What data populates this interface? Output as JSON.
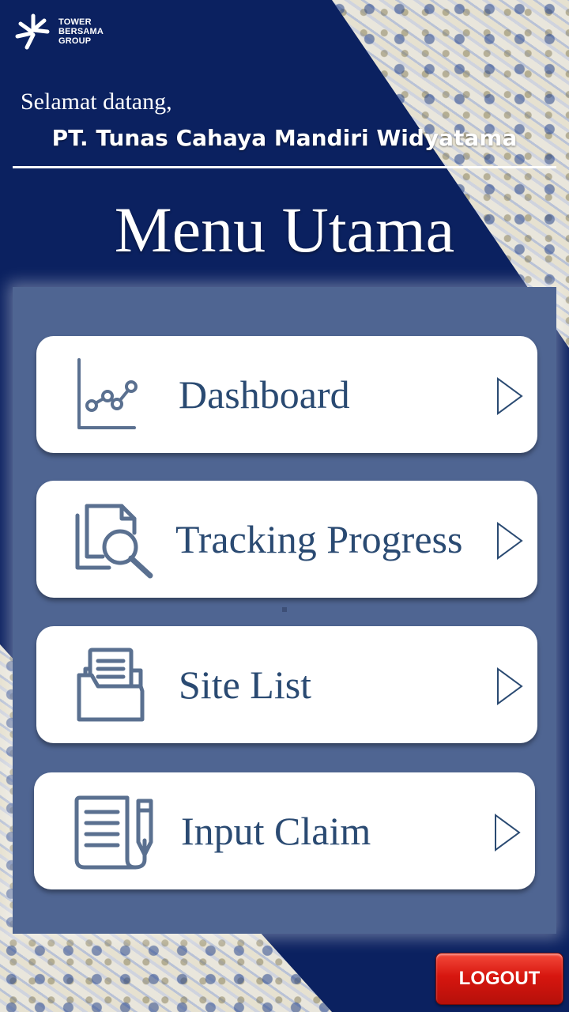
{
  "brand": {
    "line1": "TOWER",
    "line2": "BERSAMA",
    "line3": "GROUP"
  },
  "header": {
    "welcome": "Selamat datang,",
    "company": "PT. Tunas Cahaya Mandiri Widyatama",
    "title": "Menu Utama"
  },
  "menu": {
    "items": [
      {
        "label": "Dashboard",
        "icon": "line-chart-icon"
      },
      {
        "label": "Tracking Progress",
        "icon": "document-search-icon"
      },
      {
        "label": "Site List",
        "icon": "folder-documents-icon"
      },
      {
        "label": "Input Claim",
        "icon": "document-pencil-icon"
      }
    ]
  },
  "footer": {
    "logout_label": "LOGOUT"
  },
  "colors": {
    "background": "#0b2160",
    "panel": "#4f6592",
    "label_text": "#2a4a72",
    "icon": "#5a7090",
    "logout": "#d7160f"
  }
}
